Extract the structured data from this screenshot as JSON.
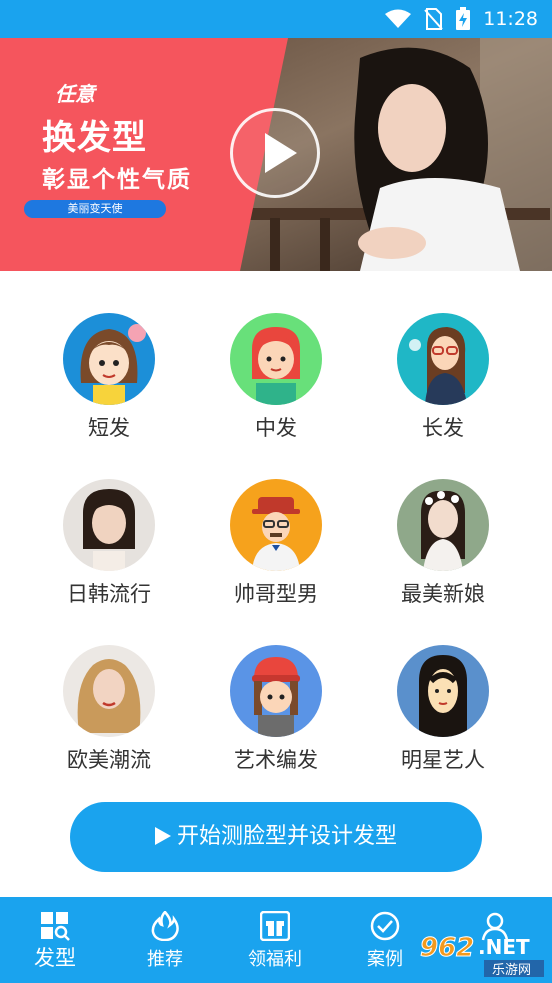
{
  "status_bar": {
    "time": "11:28",
    "icons": [
      "wifi-icon",
      "no-sim-icon",
      "battery-charging-icon"
    ]
  },
  "banner": {
    "line1": "任意",
    "line2": "换发型",
    "line3": "彰显个性气质",
    "pill": "美丽变天使",
    "play_icon": "play-icon"
  },
  "categories": [
    {
      "label": "短发"
    },
    {
      "label": "中发"
    },
    {
      "label": "长发"
    },
    {
      "label": "日韩流行"
    },
    {
      "label": "帅哥型男"
    },
    {
      "label": "最美新娘"
    },
    {
      "label": "欧美潮流"
    },
    {
      "label": "艺术编发"
    },
    {
      "label": "明星艺人"
    }
  ],
  "start_button": {
    "label": "开始测脸型并设计发型"
  },
  "bottom_nav": [
    {
      "label": "发型",
      "icon": "grid-search-icon"
    },
    {
      "label": "推荐",
      "icon": "flame-icon"
    },
    {
      "label": "领福利",
      "icon": "gift-icon"
    },
    {
      "label": "案例",
      "icon": "check-circle-icon"
    },
    {
      "label": "",
      "icon": "user-icon"
    }
  ],
  "watermark": {
    "line1": "962.NET",
    "line2": "乐游网"
  },
  "colors": {
    "primary": "#1aa3ee",
    "banner_red": "#f5555d",
    "text": "#333333"
  }
}
